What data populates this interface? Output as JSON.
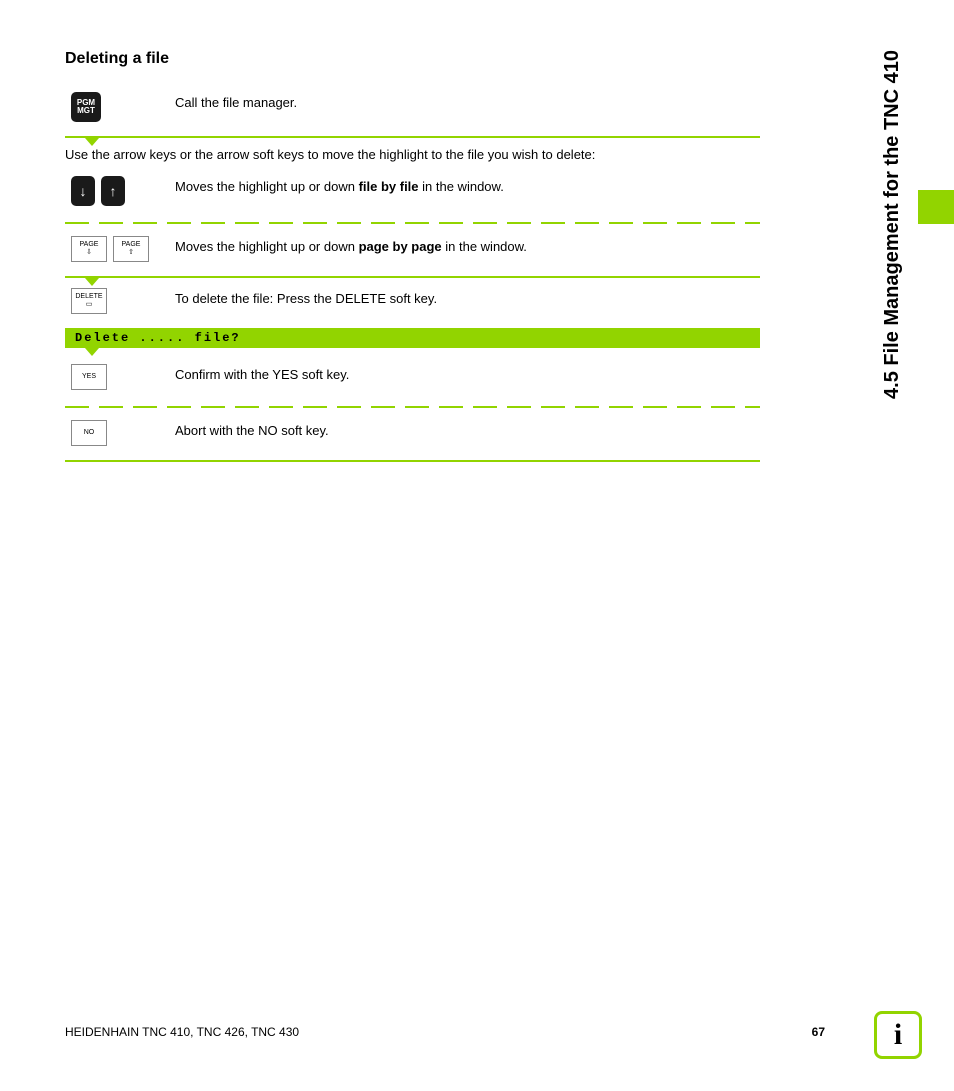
{
  "section": {
    "title": "Deleting a file"
  },
  "intro": "Use the arrow keys or the arrow soft keys to move the highlight to the file you wish to delete:",
  "steps": {
    "s1": {
      "key1_line1": "PGM",
      "key1_line2": "MGT",
      "desc": "Call the file manager."
    },
    "s2": {
      "arrow_down": "↓",
      "arrow_up": "↑",
      "desc_pre": "Moves the highlight up or down ",
      "desc_bold": "file by file",
      "desc_post": " in the window."
    },
    "s3": {
      "key1_top": "PAGE",
      "key1_arrow": "⇩",
      "key2_top": "PAGE",
      "key2_arrow": "⇧",
      "desc_pre": "Moves the highlight up or down ",
      "desc_bold": "page by page",
      "desc_post": " in the window."
    },
    "s4": {
      "key_top": "DELETE",
      "key_icon": "▭",
      "desc": "To delete the file: Press the DELETE soft key."
    },
    "prompt": "Delete ..... file?",
    "s5": {
      "key": "YES",
      "desc": "Confirm with the YES soft key."
    },
    "s6": {
      "key": "NO",
      "desc": "Abort with the NO soft key."
    }
  },
  "side_title": "4.5 File Management for the TNC 410",
  "footer": {
    "left": "HEIDENHAIN TNC 410, TNC 426, TNC 430",
    "page": "67"
  },
  "info_icon": "i"
}
